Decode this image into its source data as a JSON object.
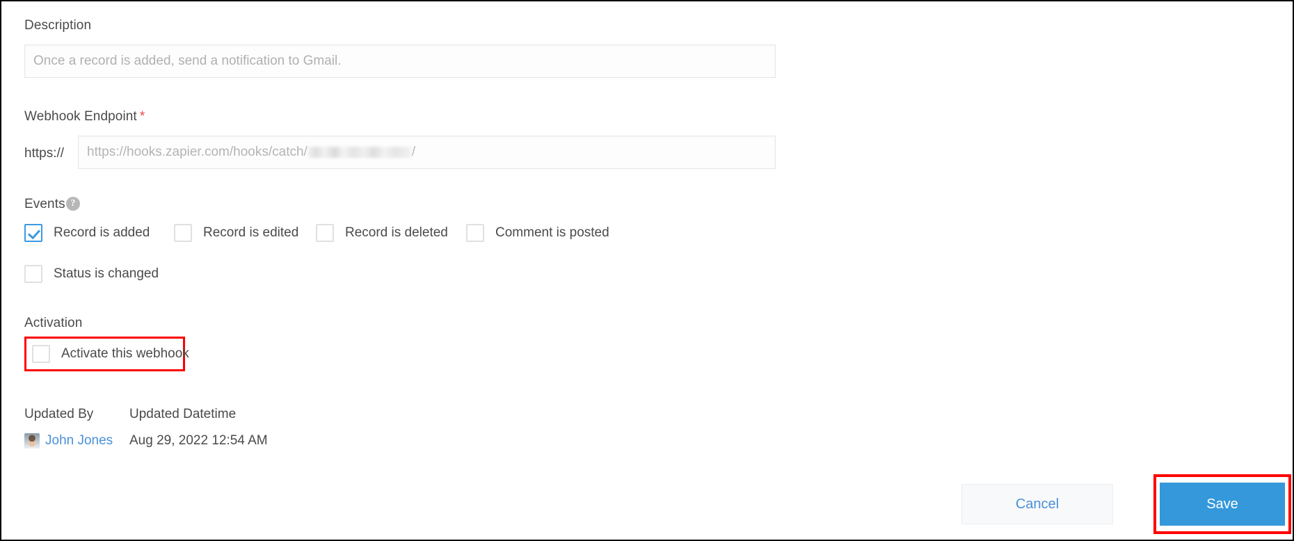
{
  "description": {
    "label": "Description",
    "placeholder": "Once a record is added, send a notification to Gmail.",
    "value": ""
  },
  "webhook_endpoint": {
    "label": "Webhook Endpoint",
    "required_marker": "*",
    "protocol_prefix": "https://",
    "placeholder_prefix": "https://hooks.zapier.com/hooks/catch/",
    "placeholder_suffix": "/",
    "value": ""
  },
  "events": {
    "label": "Events",
    "help_icon_glyph": "?",
    "items": [
      {
        "label": "Record is added",
        "checked": true
      },
      {
        "label": "Record is edited",
        "checked": false
      },
      {
        "label": "Record is deleted",
        "checked": false
      },
      {
        "label": "Comment is posted",
        "checked": false
      },
      {
        "label": "Status is changed",
        "checked": false
      }
    ]
  },
  "activation": {
    "label": "Activation",
    "checkbox_label": "Activate this webhook",
    "checked": false,
    "highlight_color": "#ff0000"
  },
  "metadata": {
    "updated_by_header": "Updated By",
    "updated_datetime_header": "Updated Datetime",
    "updated_by_name": "John Jones",
    "updated_datetime": "Aug 29, 2022 12:54 AM"
  },
  "footer": {
    "cancel_label": "Cancel",
    "save_label": "Save",
    "save_color": "#3498db",
    "cancel_text_color": "#4a90d9",
    "save_highlight_color": "#ff0000"
  }
}
